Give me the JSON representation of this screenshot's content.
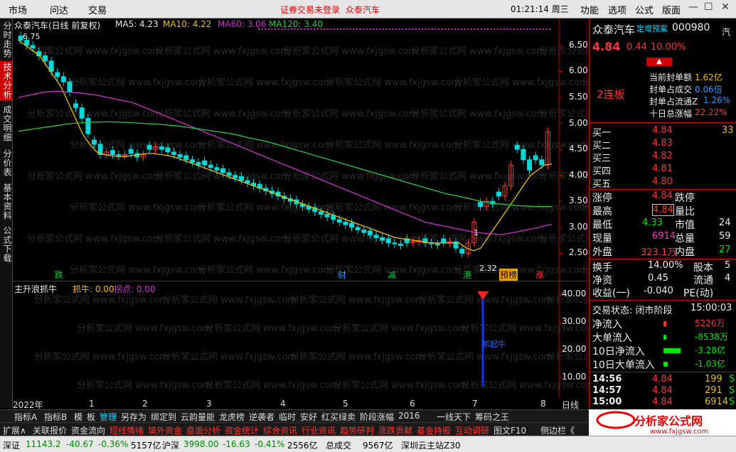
{
  "topbar": {
    "menus": [
      "市场",
      "问达",
      "交易"
    ],
    "notice_login": "证券交易未登录",
    "notice_stock": "众泰汽车",
    "clock": "01:21:14 周三",
    "right_menus": [
      "功能",
      "选项",
      "公式",
      "版面"
    ],
    "win_buttons": [
      "—",
      "☐",
      "✕"
    ]
  },
  "left_tabs": [
    "分时走势",
    "技术分析",
    "成交明细",
    "分价表",
    "基本资料",
    "公式下载"
  ],
  "chart": {
    "title": "众泰汽车(日线 前复权)",
    "ma": [
      {
        "label": "MA5: 4.23",
        "color": "#e8e8e8"
      },
      {
        "label": "MA10: 4.22",
        "color": "#f0c000"
      },
      {
        "label": "MA60: 3.06",
        "color": "#cc33cc"
      },
      {
        "label": "MA120: 3.40",
        "color": "#22cc44"
      }
    ],
    "price_axis": [
      "6.50",
      "6.00",
      "5.50",
      "5.00",
      "4.50",
      "4.00",
      "3.50",
      "3.00",
      "2.50"
    ],
    "high_label": "6.75",
    "low_label": "2.32",
    "marker_1": "1",
    "markers": [
      {
        "text": "跌",
        "color": "#00cc44",
        "bg": "#000"
      },
      {
        "text": "财",
        "color": "#3399ff",
        "bg": "#000"
      },
      {
        "text": "减",
        "color": "#00cc44",
        "bg": "#000"
      },
      {
        "text": "港",
        "color": "#00cc44",
        "bg": "#000"
      },
      {
        "text": "预榜",
        "color": "#000",
        "bg": "#e8a000"
      },
      {
        "text": "涨",
        "color": "#ff3333",
        "bg": "#000"
      }
    ],
    "watermark": "分析家公式网 www.fxjgsw.com",
    "chart_data": {
      "type": "candlestick",
      "ylim": [
        2.3,
        6.8
      ],
      "close": [
        6.6,
        6.5,
        6.45,
        6.3,
        6.2,
        6.0,
        5.9,
        5.8,
        5.6,
        5.3,
        5.1,
        4.8,
        4.6,
        4.4,
        4.45,
        4.4,
        4.38,
        4.4,
        4.42,
        4.35,
        4.4,
        4.5,
        4.55,
        4.5,
        4.45,
        4.4,
        4.35,
        4.3,
        4.25,
        4.2,
        4.2,
        4.15,
        4.1,
        4.05,
        4.0,
        3.95,
        3.9,
        3.85,
        3.8,
        3.75,
        3.7,
        3.65,
        3.6,
        3.55,
        3.5,
        3.45,
        3.4,
        3.35,
        3.3,
        3.25,
        3.2,
        3.15,
        3.1,
        3.05,
        3.0,
        2.95,
        2.9,
        2.85,
        2.8,
        2.75,
        2.7,
        2.68,
        2.65,
        2.7,
        2.72,
        2.75,
        2.7,
        2.68,
        2.66,
        2.7,
        2.72,
        2.6,
        2.5,
        2.7,
        3.1,
        3.4,
        3.5,
        3.45,
        3.6,
        3.8,
        4.2,
        4.5,
        4.3,
        4.1,
        4.3,
        4.2,
        4.84
      ],
      "ma10": [
        6.6,
        6.5,
        6.4,
        6.3,
        6.1,
        5.9,
        5.7,
        5.4,
        5.1,
        4.8,
        4.6,
        4.45,
        4.4,
        4.38,
        4.36,
        4.36,
        4.38,
        4.4,
        4.42,
        4.42,
        4.4,
        4.38,
        4.35,
        4.3,
        4.25,
        4.2,
        4.15,
        4.1,
        4.05,
        4.0,
        3.95,
        3.9,
        3.85,
        3.8,
        3.75,
        3.7,
        3.65,
        3.6,
        3.55,
        3.5,
        3.45,
        3.4,
        3.35,
        3.3,
        3.25,
        3.2,
        3.15,
        3.1,
        3.05,
        3.0,
        2.95,
        2.9,
        2.85,
        2.8,
        2.78,
        2.76,
        2.74,
        2.72,
        2.7,
        2.7,
        2.7,
        2.7,
        2.7,
        2.6,
        2.55,
        2.6,
        2.8,
        3.0,
        3.2,
        3.4,
        3.6,
        3.8,
        4.0,
        4.1,
        4.2,
        4.22
      ],
      "ma60": [
        5.5,
        5.55,
        5.6,
        5.62,
        5.6,
        5.58,
        5.55,
        5.5,
        5.45,
        5.4,
        5.3,
        5.2,
        5.1,
        5.0,
        4.9,
        4.8,
        4.7,
        4.6,
        4.5,
        4.4,
        4.3,
        4.2,
        4.1,
        4.0,
        3.9,
        3.8,
        3.7,
        3.6,
        3.5,
        3.4,
        3.3,
        3.2,
        3.1,
        3.05,
        3.0,
        2.95,
        2.9,
        2.88,
        2.86,
        2.9,
        2.95,
        3.0,
        3.06
      ],
      "ma120": [
        4.85,
        4.9,
        4.95,
        5.0,
        5.02,
        5.03,
        5.02,
        5.0,
        4.98,
        4.95,
        4.9,
        4.85,
        4.8,
        4.72,
        4.65,
        4.55,
        4.45,
        4.35,
        4.25,
        4.15,
        4.05,
        3.95,
        3.85,
        3.75,
        3.65,
        3.58,
        3.5,
        3.45,
        3.42,
        3.4,
        3.4
      ]
    }
  },
  "indicator": {
    "title": "主升浪抓牛",
    "label1": "抓牛: 0.00",
    "label2": "拐点: 0.00",
    "axis": [
      "40.00",
      "30.00",
      "20.00",
      "10.00"
    ],
    "signal_text": "抓起牛"
  },
  "xaxis": {
    "labels": [
      "2022年",
      "1",
      "2",
      "3",
      "4",
      "5",
      "6",
      "7",
      "8"
    ],
    "period": "日线"
  },
  "tabs": [
    "指标A",
    "指标B",
    "模",
    "板",
    "管理",
    "另存为",
    "绑定到",
    "云韵量能",
    "龙虎榜",
    "逆袭者",
    "临时",
    "安好",
    "红买绿卖",
    "阶段涨幅",
    "2016",
    "一线天下",
    "筹码之王"
  ],
  "func_bar": [
    "扩展∧",
    "关联报价",
    "资金流向",
    "短线情绪",
    "填外资金",
    "盘面分析",
    "资金统计",
    "综合资讯",
    "行业资讯",
    "趋势研判",
    "涨跌贡献",
    "基金持股",
    "互动调研",
    "图文F10",
    "侧边栏《"
  ],
  "right": {
    "name": "众泰汽车",
    "tag": "定增预案",
    "code": "000980",
    "price": "4.84",
    "change": "0.44",
    "pct": "10.00%",
    "side_label": "汽",
    "limit_up_label": "2连板",
    "seal": [
      {
        "k": "当前封单额",
        "v": "1.62亿"
      },
      {
        "k": "封单占成交",
        "v": "0.06倍"
      },
      {
        "k": "封单占流通Z",
        "v": "1.26%"
      },
      {
        "k": "十日总涨幅",
        "v": "22.22%"
      }
    ],
    "buy": [
      {
        "k": "买一",
        "v": "4.84",
        "n": "33"
      },
      {
        "k": "买二",
        "v": "4.83",
        "n": ""
      },
      {
        "k": "买三",
        "v": "4.82",
        "n": ""
      },
      {
        "k": "买四",
        "v": "4.81",
        "n": ""
      },
      {
        "k": "买五",
        "v": "4.80",
        "n": ""
      }
    ],
    "stats": [
      {
        "k1": "涨停",
        "v1": "4.84",
        "k2": "跌停",
        "v2": ""
      },
      {
        "k1": "最高",
        "v1": "4.84",
        "k2": "量比",
        "v2": ""
      },
      {
        "k1": "最低",
        "v1": "4.33",
        "k2": "市值",
        "v2": "24"
      },
      {
        "k1": "现量",
        "v1": "6914",
        "k2": "总量",
        "v2": "59"
      },
      {
        "k1": "外盘",
        "v1": "323.1万",
        "k2": "内盘",
        "v2": "27"
      }
    ],
    "stats2": [
      {
        "k1": "换手",
        "v1": "14.00%",
        "k2": "股本",
        "v2": "5"
      },
      {
        "k1": "净资",
        "v1": "0.45",
        "k2": "流通",
        "v2": "4"
      },
      {
        "k1": "收益(一)",
        "v1": "-0.040",
        "k2": "PE(动)",
        "v2": ""
      }
    ],
    "trade_status": "交易状态: 闭市阶段",
    "trade_time": "15:00:03",
    "flows": [
      {
        "k": "净流入",
        "v": "5226万",
        "bar": 0.05,
        "color": "#ff3333"
      },
      {
        "k": "大单流入",
        "v": "-8538万",
        "bar": 0.08,
        "color": "#00e600"
      },
      {
        "k": "10日净流入",
        "v": "-3.28亿",
        "bar": 0.6,
        "color": "#00e600"
      },
      {
        "k": "10日大单流入",
        "v": "-1.03亿",
        "bar": 0.15,
        "color": "#00e600"
      }
    ],
    "ticks": [
      {
        "t": "14:56",
        "p": "4.84",
        "n": "199",
        "s": "S"
      },
      {
        "t": "14:57",
        "p": "4.84",
        "n": "291",
        "s": "S"
      },
      {
        "t": "15:00",
        "p": "4.84",
        "n": "6914",
        "s": "S"
      }
    ],
    "logo_text": "分析家公式网",
    "logo_url": "www.fxjgsw.com"
  },
  "status": {
    "sz_label": "深证",
    "sz_val": "11143.2",
    "sz_chg": "-40.67",
    "sz_pct": "-0.36%",
    "sz_vol": "5157亿",
    "sh_label": "沪深",
    "sh_val": "3998.00",
    "sh_chg": "-16.63",
    "sh_pct": "-0.41%",
    "sh_vol": "2556亿",
    "total_label": "总成交",
    "total_val": "9567亿",
    "server": "深圳云主站Z30"
  }
}
